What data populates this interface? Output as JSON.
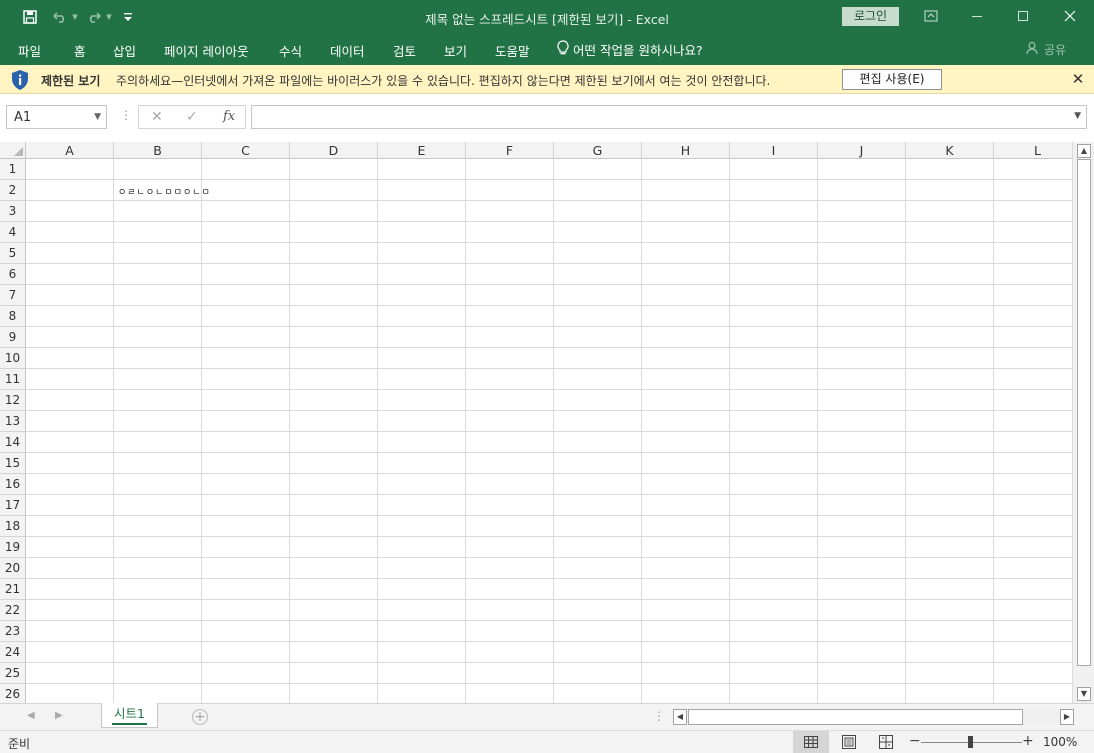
{
  "app": {
    "title": "제목 없는 스프레드시트  [제한된 보기]  -  Excel",
    "login_label": "로그인"
  },
  "menu": {
    "items": [
      {
        "label": "파일"
      },
      {
        "label": "홈"
      },
      {
        "label": "삽입"
      },
      {
        "label": "페이지 레이아웃"
      },
      {
        "label": "수식"
      },
      {
        "label": "데이터"
      },
      {
        "label": "검토"
      },
      {
        "label": "보기"
      },
      {
        "label": "도움말"
      }
    ],
    "tell_me": "어떤 작업을 원하시나요?",
    "share": "공유"
  },
  "protected_view": {
    "title": "제한된 보기",
    "message": "주의하세요—인터넷에서 가져온 파일에는 바이러스가 있을 수 있습니다. 편집하지 않는다면 제한된 보기에서 여는 것이 안전합니다.",
    "enable_label": "편집 사용(E)",
    "close": "✕"
  },
  "formula_bar": {
    "name_box": "A1",
    "fx_label": "fx",
    "formula_value": ""
  },
  "sheet": {
    "columns": [
      "A",
      "B",
      "C",
      "D",
      "E",
      "F",
      "G",
      "H",
      "I",
      "J",
      "K",
      "L"
    ],
    "rows": [
      "1",
      "2",
      "3",
      "4",
      "5",
      "6",
      "7",
      "8",
      "9",
      "10",
      "11",
      "12",
      "13",
      "14",
      "15",
      "16",
      "17",
      "18",
      "19",
      "20",
      "21",
      "22",
      "23",
      "24",
      "25",
      "26"
    ],
    "cells": {
      "B2": "ㅇㄹㄴㅇㄴㅁㅁㅇㄴㅁ"
    }
  },
  "tabs": {
    "sheets": [
      {
        "label": "시트1"
      }
    ],
    "add_label": "+"
  },
  "status": {
    "ready": "준비",
    "zoom": "100%"
  },
  "colors": {
    "accent": "#217346",
    "protected_bar": "#fff4c2"
  }
}
